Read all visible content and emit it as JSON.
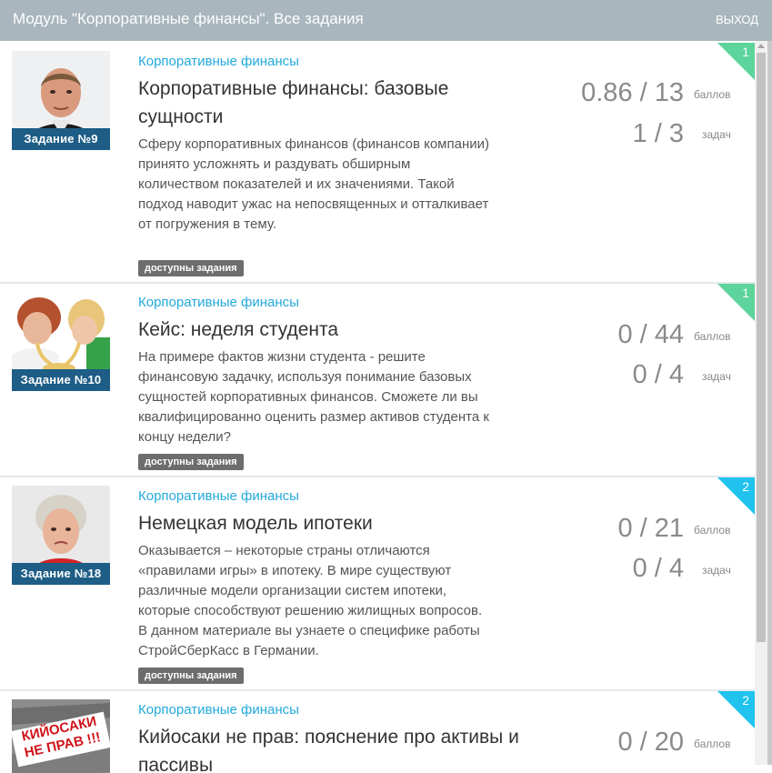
{
  "header": {
    "title": "Модуль \"Корпоративные финансы\".  Все задания",
    "exit_label": "ВЫХОД"
  },
  "tasks": [
    {
      "thumb_caption": "Задание №9",
      "category": "Корпоративные финансы",
      "title": "Корпоративные финансы: базовые сущности",
      "description": "Сферу корпоративных финансов (финансов компании) принято усложнять и раздувать обширным количеством показателей и их значениями. Такой подход наводит ужас на непосвященных и отталкивает от погружения в тему.",
      "badge": "доступны задания",
      "points": "0.86 / 13",
      "points_label": "баллов",
      "tasks_count": "1 / 3",
      "tasks_label": "задач",
      "corner_number": "1",
      "corner_color": "#5cd49b"
    },
    {
      "thumb_caption": "Задание №10",
      "category": "Корпоративные финансы",
      "title": "Кейс: неделя студента",
      "description": "На примере фактов жизни студента - решите финансовую задачку, используя понимание базовых сущностей корпоративных финансов. Сможете ли вы квалифицированно оценить размер активов студента к концу недели?",
      "badge": "доступны задания",
      "points": "0 / 44",
      "points_label": "баллов",
      "tasks_count": "0 / 4",
      "tasks_label": "задач",
      "corner_number": "1",
      "corner_color": "#5cd49b"
    },
    {
      "thumb_caption": "Задание №18",
      "category": "Корпоративные финансы",
      "title": "Немецкая модель ипотеки",
      "description": "Оказывается – некоторые страны отличаются «правилами игры» в ипотеку. В мире существуют различные модели организации систем ипотеки, которые способствуют решению жилищных вопросов. В данном материале вы узнаете о специфике работы СтройСберКасс в Германии.",
      "badge": "доступны задания",
      "points": "0 / 21",
      "points_label": "баллов",
      "tasks_count": "0 / 4",
      "tasks_label": "задач",
      "corner_number": "2",
      "corner_color": "#1fc3ee"
    },
    {
      "thumb_caption": "КИЙОСАКИ НЕ ПРАВ !!!",
      "category": "Корпоративные финансы",
      "title": "Кийосаки не прав: пояснение про активы и пассивы",
      "points": "0 / 20",
      "points_label": "баллов",
      "corner_number": "2",
      "corner_color": "#1fc3ee"
    }
  ]
}
